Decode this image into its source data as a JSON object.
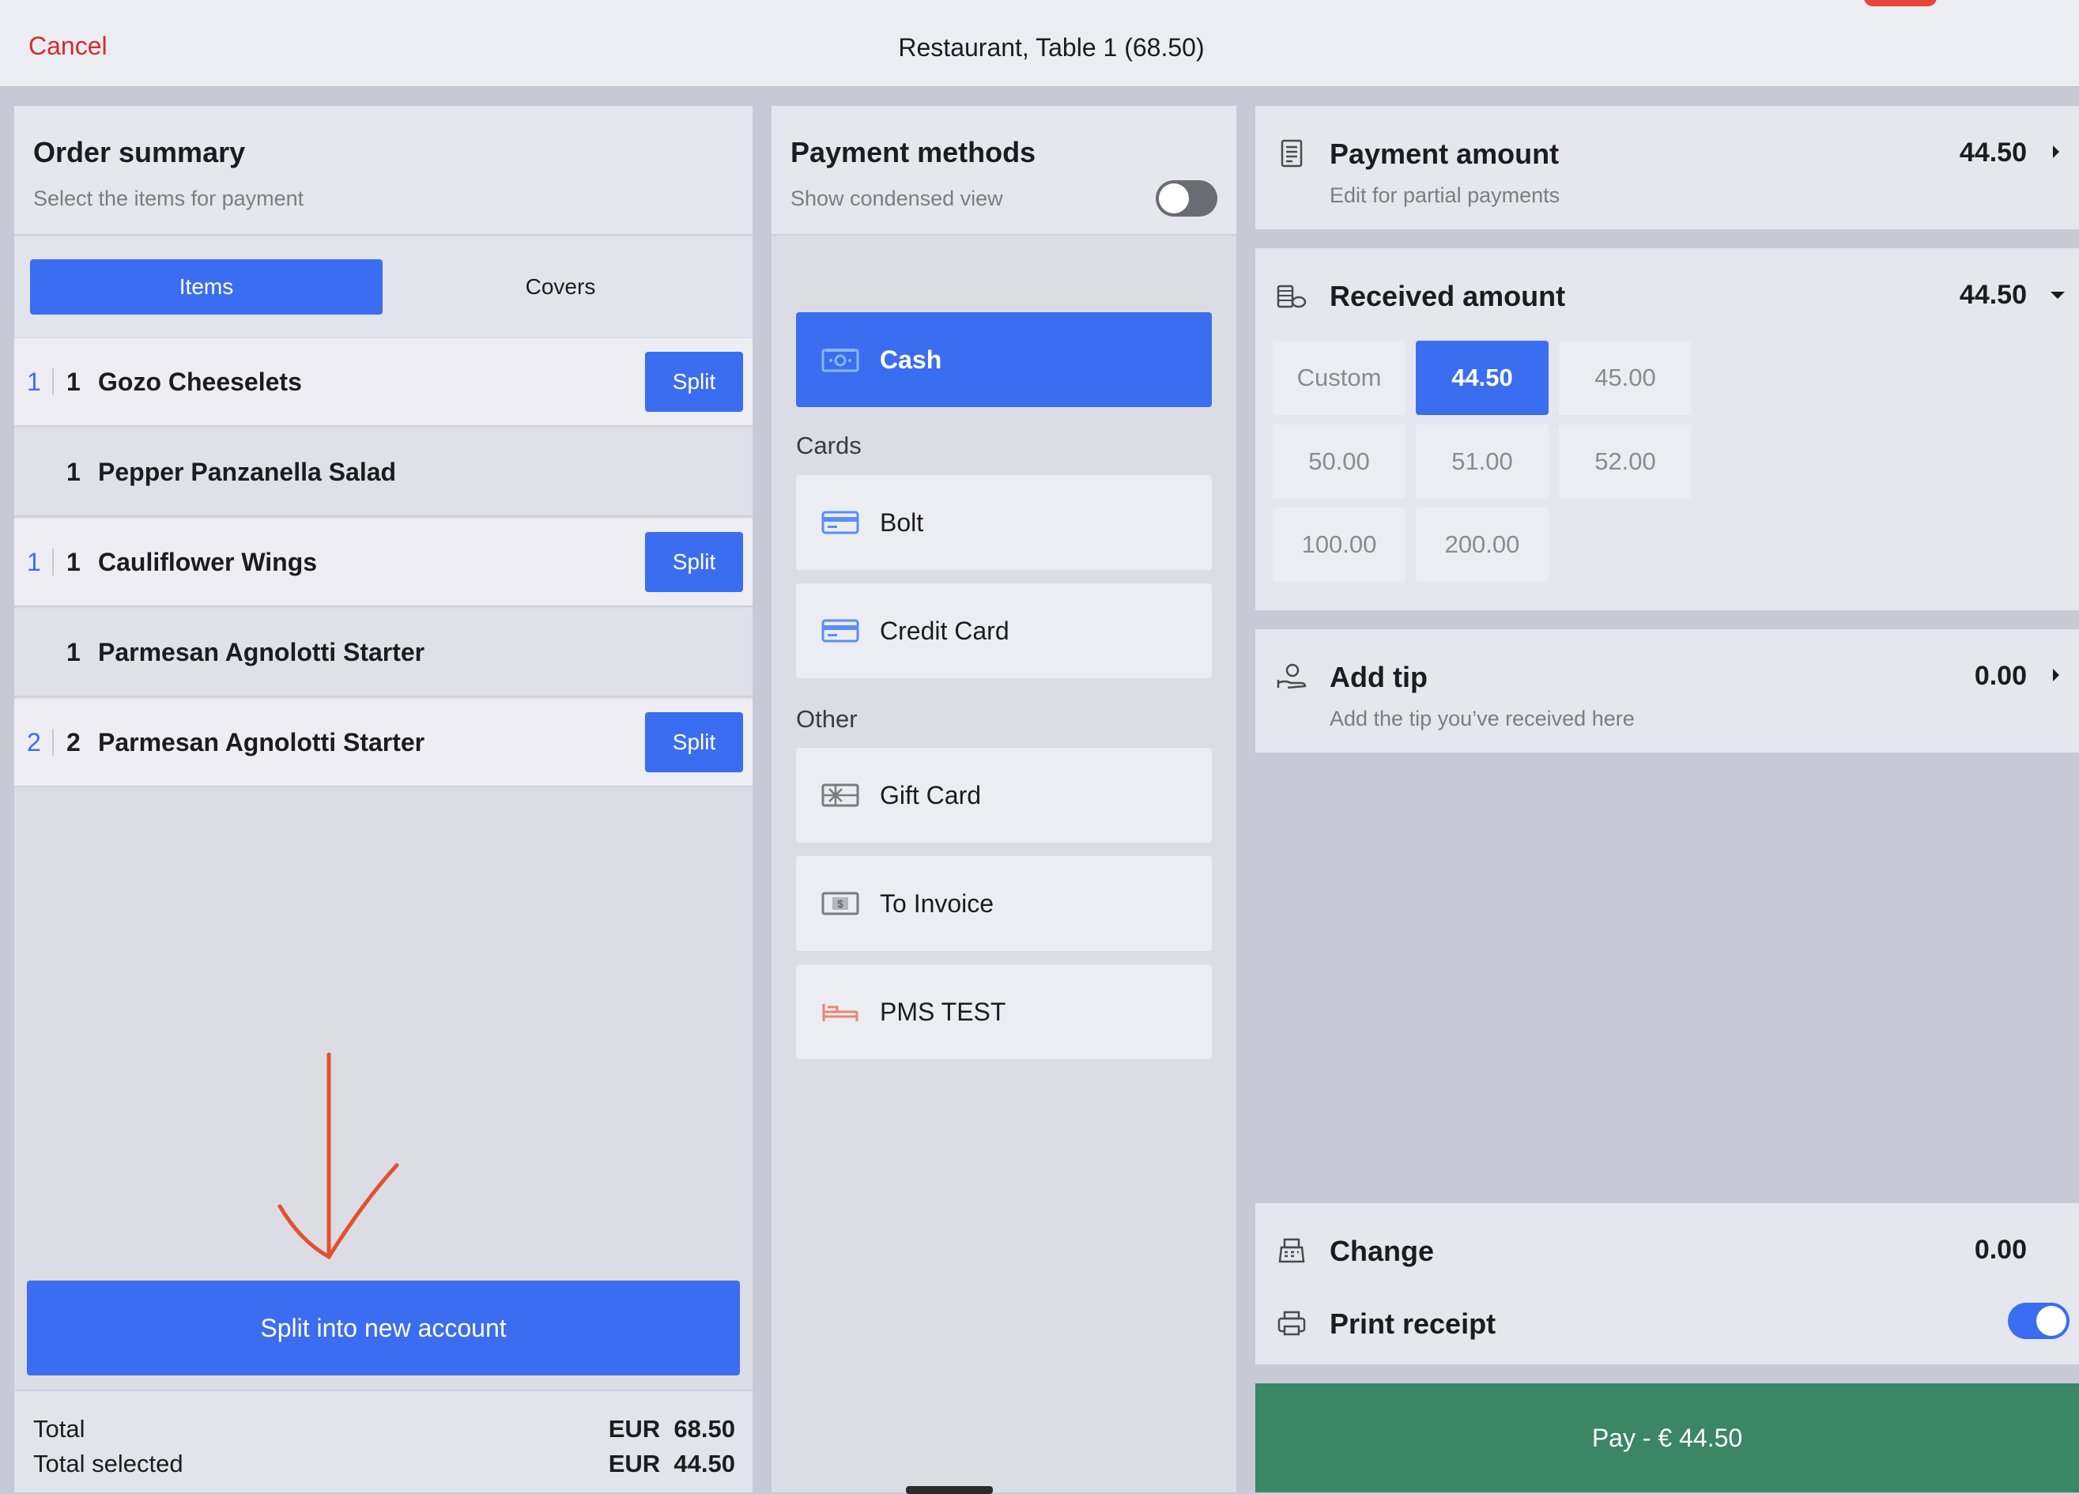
{
  "topbar": {
    "cancel_label": "Cancel",
    "title": "Restaurant, Table 1 (68.50)"
  },
  "order_summary": {
    "title": "Order summary",
    "subtitle": "Select the items for payment",
    "tabs": [
      {
        "label": "Items",
        "active": true
      },
      {
        "label": "Covers",
        "active": false
      }
    ],
    "rows": [
      {
        "selected_qty": "1",
        "qty": "1",
        "name": "Gozo Cheeselets",
        "split_label": "Split",
        "selected": true
      },
      {
        "selected_qty": "",
        "qty": "1",
        "name": "Pepper Panzanella Salad",
        "split_label": "",
        "selected": false
      },
      {
        "selected_qty": "1",
        "qty": "1",
        "name": "Cauliflower Wings",
        "split_label": "Split",
        "selected": true
      },
      {
        "selected_qty": "",
        "qty": "1",
        "name": "Parmesan Agnolotti Starter",
        "split_label": "",
        "selected": false
      },
      {
        "selected_qty": "2",
        "qty": "2",
        "name": "Parmesan Agnolotti Starter",
        "split_label": "Split",
        "selected": true
      }
    ],
    "split_new_label": "Split into new account",
    "total_label": "Total",
    "total_value": "EUR  68.50",
    "total_selected_label": "Total selected",
    "total_selected_value": "EUR  44.50"
  },
  "payment_methods": {
    "title": "Payment methods",
    "condensed_label": "Show condensed view",
    "condensed_on": false,
    "cash": {
      "label": "Cash",
      "icon": "cash-icon",
      "active": true
    },
    "cards_label": "Cards",
    "cards": [
      {
        "label": "Bolt",
        "icon": "card-icon"
      },
      {
        "label": "Credit Card",
        "icon": "card-icon"
      }
    ],
    "other_label": "Other",
    "other": [
      {
        "label": "Gift Card",
        "icon": "gift-card-icon"
      },
      {
        "label": "To Invoice",
        "icon": "invoice-icon"
      },
      {
        "label": "PMS TEST",
        "icon": "bed-icon"
      }
    ]
  },
  "payment_amount": {
    "title": "Payment amount",
    "subtitle": "Edit for partial payments",
    "value": "44.50"
  },
  "received_amount": {
    "title": "Received amount",
    "value": "44.50",
    "options": [
      "Custom",
      "44.50",
      "45.00",
      "50.00",
      "51.00",
      "52.00",
      "100.00",
      "200.00"
    ],
    "selected": "44.50"
  },
  "tip": {
    "title": "Add tip",
    "subtitle": "Add the tip you’ve received here",
    "value": "0.00"
  },
  "change": {
    "title": "Change",
    "value": "0.00"
  },
  "print_receipt": {
    "title": "Print receipt",
    "on": true
  },
  "pay_label": "Pay - € 44.50",
  "colors": {
    "accent": "#3b6df0",
    "pay": "#3a8665",
    "cancel": "#d12e2a",
    "annotation": "#e4502f"
  }
}
